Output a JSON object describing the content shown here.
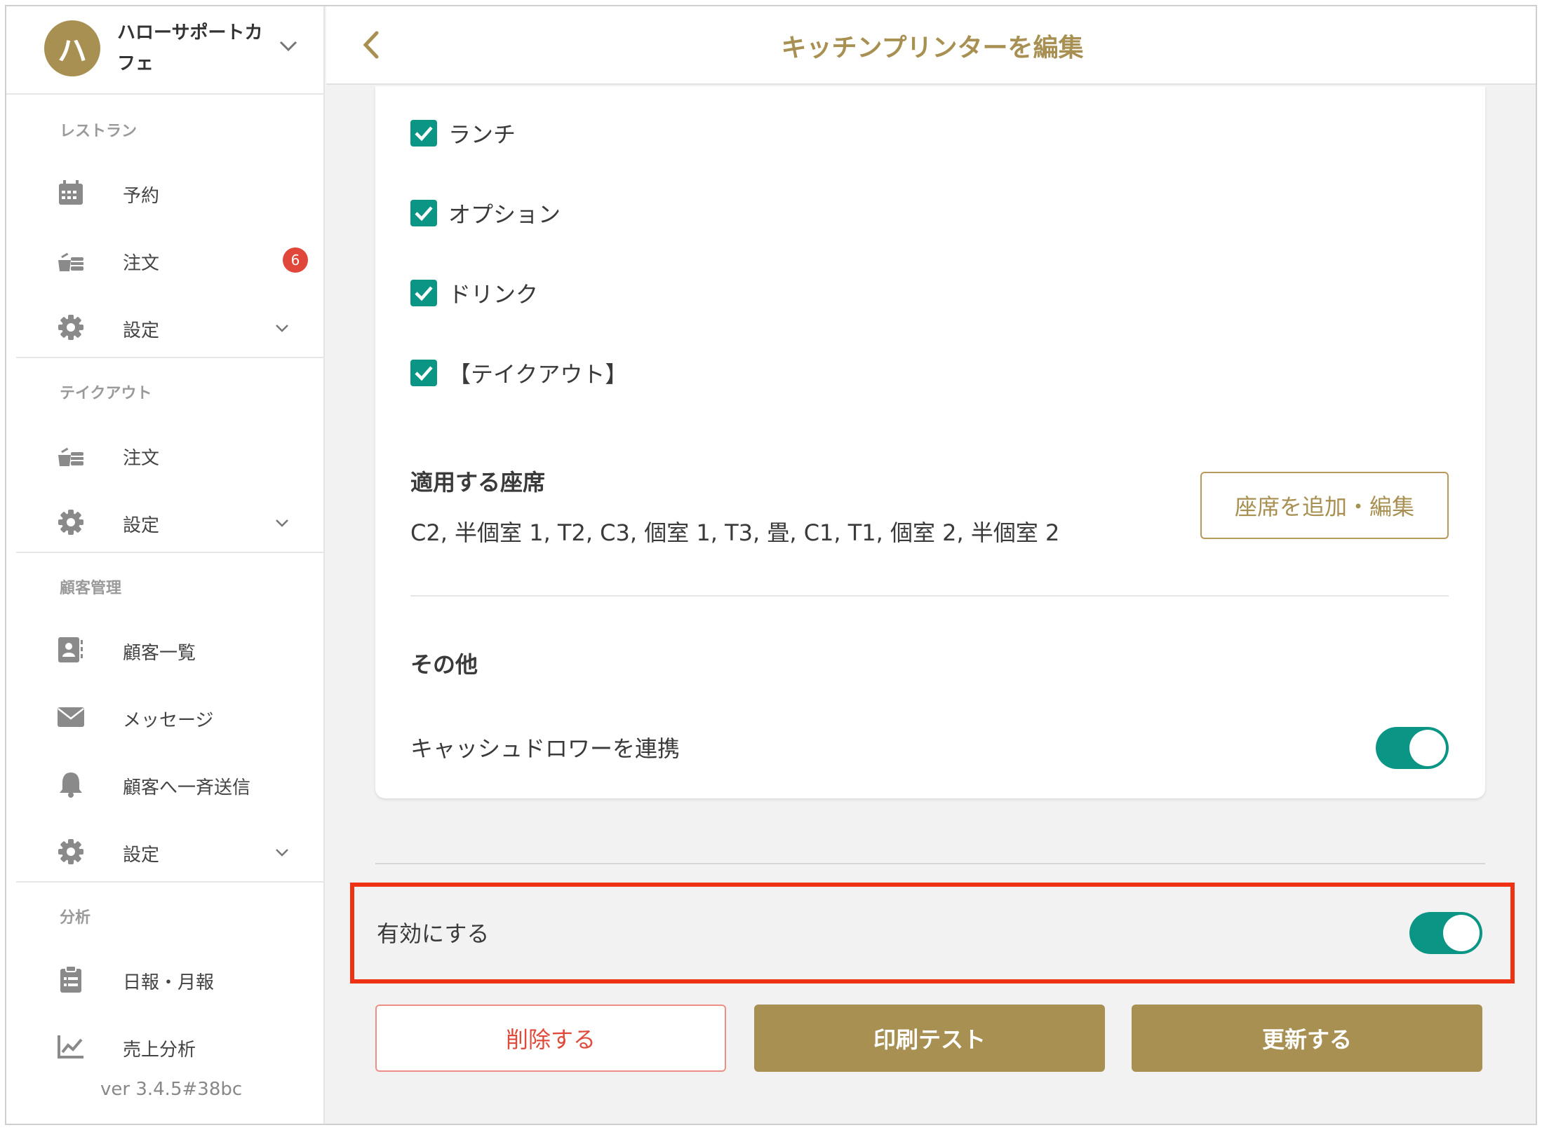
{
  "brand": {
    "initial": "ハ",
    "name": "ハローサポートカフェ"
  },
  "sidebar": {
    "sections": [
      {
        "heading": "レストラン",
        "items": [
          {
            "label": "予約",
            "icon": "calendar-icon"
          },
          {
            "label": "注文",
            "icon": "order-icon",
            "badge": "6"
          },
          {
            "label": "設定",
            "icon": "gear-icon"
          }
        ]
      },
      {
        "heading": "テイクアウト",
        "items": [
          {
            "label": "注文",
            "icon": "order-icon"
          },
          {
            "label": "設定",
            "icon": "gear-icon"
          }
        ]
      },
      {
        "heading": "顧客管理",
        "items": [
          {
            "label": "顧客一覧",
            "icon": "contact-card-icon"
          },
          {
            "label": "メッセージ",
            "icon": "envelope-icon"
          },
          {
            "label": "顧客へ一斉送信",
            "icon": "bell-icon"
          },
          {
            "label": "設定",
            "icon": "gear-icon"
          }
        ]
      },
      {
        "heading": "分析",
        "items": [
          {
            "label": "日報・月報",
            "icon": "clipboard-icon"
          },
          {
            "label": "売上分析",
            "icon": "line-chart-icon"
          }
        ]
      }
    ],
    "version": "ver 3.4.5#38bc"
  },
  "header": {
    "title": "キッチンプリンターを編集"
  },
  "categories": [
    {
      "label": "ランチ",
      "checked": true
    },
    {
      "label": "オプション",
      "checked": true
    },
    {
      "label": "ドリンク",
      "checked": true
    },
    {
      "label": "【テイクアウト】",
      "checked": true
    }
  ],
  "seats": {
    "title": "適用する座席",
    "value": "C2, 半個室 1, T2, C3, 個室 1, T3, 畳, C1, T1, 個室 2, 半個室 2",
    "edit_button": "座席を追加・編集"
  },
  "other": {
    "title": "その他",
    "cash_drawer_label": "キャッシュドロワーを連携",
    "cash_drawer_on": true
  },
  "enable": {
    "label": "有効にする",
    "on": true
  },
  "actions": {
    "delete": "削除する",
    "print_test": "印刷テスト",
    "update": "更新する"
  },
  "colors": {
    "accent": "#a89052",
    "toggle": "#0b9584",
    "badge": "#e0463a",
    "highlight": "#f03214"
  }
}
